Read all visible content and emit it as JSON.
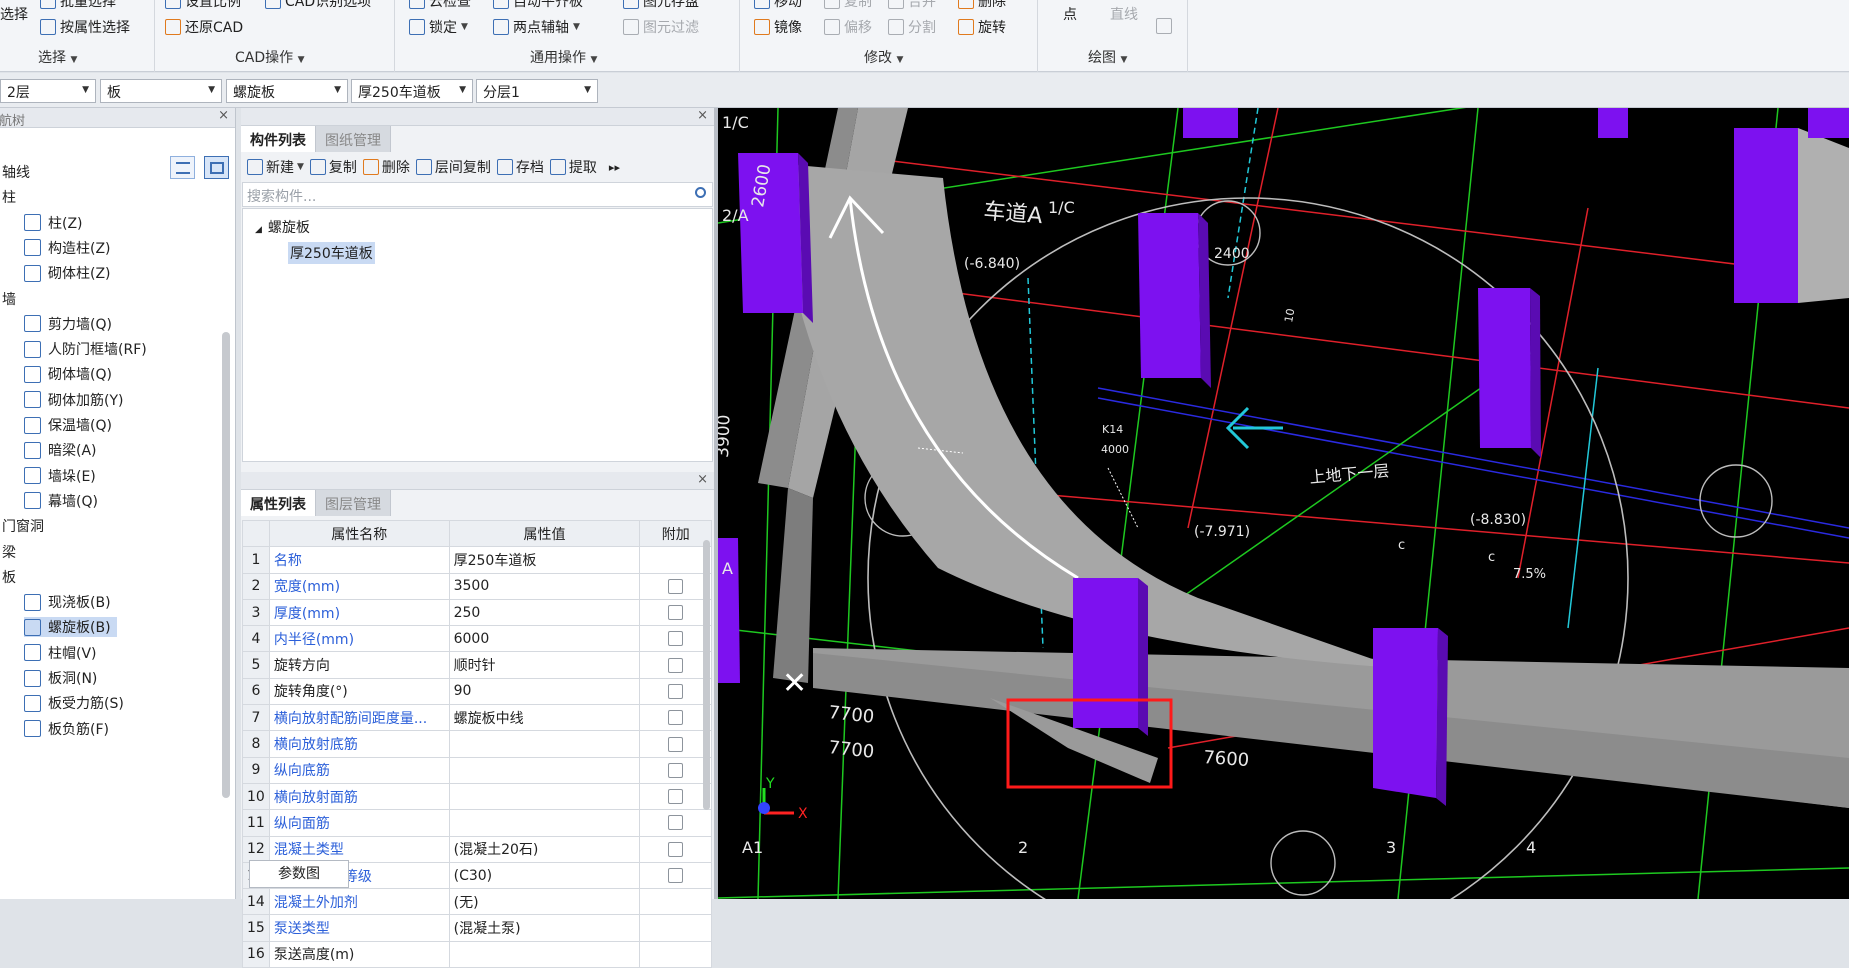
{
  "ribbon": {
    "select_group": {
      "btn_batch": "批量选择",
      "btn_attr": "按属性选择",
      "btn_select": "选择",
      "label": "选择"
    },
    "cad_group": {
      "btn_scale": "设置比例",
      "btn_identify": "CAD识别选项",
      "btn_restore": "还原CAD",
      "label": "CAD操作"
    },
    "common_group": {
      "btn_cloud": "云检查",
      "btn_auto": "自动平齐板",
      "btn_save": "图元存盘",
      "btn_lock": "锁定",
      "btn_aux": "两点辅轴",
      "btn_filter": "图元过滤",
      "label": "通用操作"
    },
    "modify_group": {
      "btn_move": "移动",
      "btn_copy": "复制",
      "btn_merge": "合并",
      "btn_delete": "删除",
      "btn_mirror": "镜像",
      "btn_offset": "偏移",
      "btn_split": "分割",
      "btn_rotate": "旋转",
      "label": "修改"
    },
    "draw_group": {
      "btn_point": "点",
      "btn_line": "直线",
      "label": "绘图"
    }
  },
  "selectors": [
    "2层",
    "板",
    "螺旋板",
    "厚250车道板",
    "分层1"
  ],
  "nav": {
    "title": "导航树",
    "items": [
      {
        "label": "轴线",
        "level": 0
      },
      {
        "label": "柱",
        "level": 0
      },
      {
        "label": "柱(Z)",
        "level": 1
      },
      {
        "label": "构造柱(Z)",
        "level": 1
      },
      {
        "label": "砌体柱(Z)",
        "level": 1
      },
      {
        "label": "墙",
        "level": 0
      },
      {
        "label": "剪力墙(Q)",
        "level": 1
      },
      {
        "label": "人防门框墙(RF)",
        "level": 1
      },
      {
        "label": "砌体墙(Q)",
        "level": 1
      },
      {
        "label": "砌体加筋(Y)",
        "level": 1
      },
      {
        "label": "保温墙(Q)",
        "level": 1
      },
      {
        "label": "暗梁(A)",
        "level": 1
      },
      {
        "label": "墙垛(E)",
        "level": 1
      },
      {
        "label": "幕墙(Q)",
        "level": 1
      },
      {
        "label": "门窗洞",
        "level": 0
      },
      {
        "label": "梁",
        "level": 0
      },
      {
        "label": "板",
        "level": 0
      },
      {
        "label": "现浇板(B)",
        "level": 1
      },
      {
        "label": "螺旋板(B)",
        "level": 1
      },
      {
        "label": "柱帽(V)",
        "level": 1
      },
      {
        "label": "板洞(N)",
        "level": 1
      },
      {
        "label": "板受力筋(S)",
        "level": 1
      },
      {
        "label": "板负筋(F)",
        "level": 1
      }
    ]
  },
  "components": {
    "tabs": [
      "构件列表",
      "图纸管理"
    ],
    "toolbar": {
      "new": "新建",
      "copy": "复制",
      "delete": "删除",
      "floor_copy": "层间复制",
      "save": "存档",
      "extract": "提取"
    },
    "search_placeholder": "搜索构件...",
    "tree_parent": "螺旋板",
    "tree_child": "厚250车道板"
  },
  "properties": {
    "tabs": [
      "属性列表",
      "图层管理"
    ],
    "headers": [
      "属性名称",
      "属性值",
      "附加"
    ],
    "rows": [
      {
        "n": "1",
        "k": "名称",
        "v": "厚250车道板",
        "blue": true,
        "cb": false
      },
      {
        "n": "2",
        "k": "宽度(mm)",
        "v": "3500",
        "blue": true,
        "cb": true
      },
      {
        "n": "3",
        "k": "厚度(mm)",
        "v": "250",
        "blue": true,
        "cb": true
      },
      {
        "n": "4",
        "k": "内半径(mm)",
        "v": "6000",
        "blue": true,
        "cb": true
      },
      {
        "n": "5",
        "k": "旋转方向",
        "v": "顺时针",
        "blue": false,
        "cb": true
      },
      {
        "n": "6",
        "k": "旋转角度(°)",
        "v": "90",
        "blue": false,
        "cb": true
      },
      {
        "n": "7",
        "k": "横向放射配筋间距度量...",
        "v": "螺旋板中线",
        "blue": true,
        "cb": true
      },
      {
        "n": "8",
        "k": "横向放射底筋",
        "v": "",
        "blue": true,
        "cb": true
      },
      {
        "n": "9",
        "k": "纵向底筋",
        "v": "",
        "blue": true,
        "cb": true
      },
      {
        "n": "10",
        "k": "横向放射面筋",
        "v": "",
        "blue": true,
        "cb": true
      },
      {
        "n": "11",
        "k": "纵向面筋",
        "v": "",
        "blue": true,
        "cb": true
      },
      {
        "n": "12",
        "k": "混凝土类型",
        "v": "(混凝土20石)",
        "blue": true,
        "cb": true
      },
      {
        "n": "13",
        "k": "混凝土强度等级",
        "v": "(C30)",
        "blue": true,
        "cb": true
      },
      {
        "n": "14",
        "k": "混凝土外加剂",
        "v": "(无)",
        "blue": true,
        "cb": false
      },
      {
        "n": "15",
        "k": "泵送类型",
        "v": "(混凝土泵)",
        "blue": true,
        "cb": false
      },
      {
        "n": "16",
        "k": "泵送高度(m)",
        "v": "",
        "blue": false,
        "cb": false
      }
    ],
    "param_button": "参数图"
  },
  "viewport": {
    "axis_labels": [
      "1/C",
      "2/A",
      "A",
      "A1",
      "2",
      "3",
      "4"
    ],
    "dims": [
      "2600",
      "3900",
      "7700",
      "7700",
      "7600",
      "2400",
      "4000"
    ],
    "elevations": [
      "(-6.840)",
      "(-7.971)",
      "(-8.830)"
    ],
    "texts": [
      "车道A",
      "上地下一层",
      "7.5%",
      "K14",
      "c",
      "c",
      "X",
      "Y",
      "10"
    ],
    "colors": {
      "column": "#7d11f0",
      "wall": "#8c8c8c",
      "ramp": "#a7a7a7",
      "grid_green": "#1ec820",
      "grid_red": "#e0202a",
      "highlight": "#ff1a1a",
      "cyan": "#22c8d8"
    }
  }
}
